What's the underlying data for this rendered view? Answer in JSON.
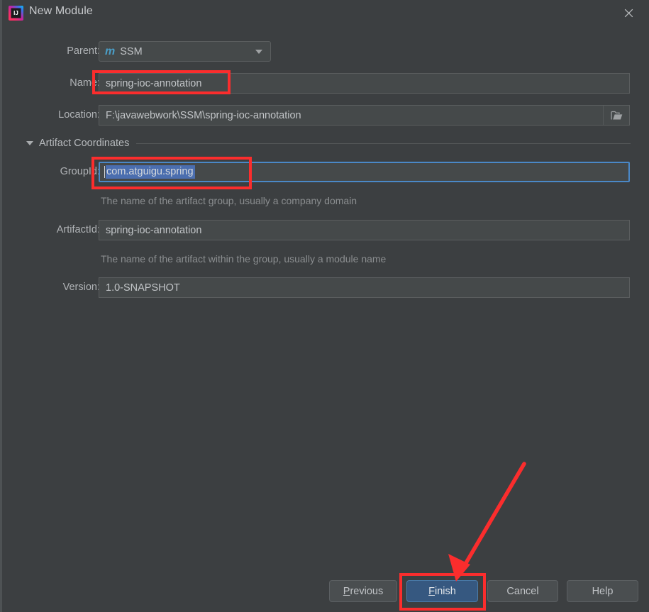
{
  "window": {
    "title": "New Module",
    "app_icon": "intellij-idea-logo",
    "close_icon": "close-icon",
    "background": "#3c3f41"
  },
  "form": {
    "parent": {
      "label": "Parent:",
      "value": "SSM",
      "icon": "maven-module-icon",
      "icon_glyph": "m",
      "icon_color": "#4a9ec7",
      "arrow_icon": "chevron-down-icon"
    },
    "name": {
      "label": "Name:",
      "value": "spring-ioc-annotation"
    },
    "location": {
      "label": "Location:",
      "value": "F:\\javawebwork\\SSM\\spring-ioc-annotation",
      "browse_icon": "folder-open-icon"
    },
    "artifact_section": {
      "label": "Artifact Coordinates",
      "expanded": true,
      "triangle_icon": "triangle-down-icon"
    },
    "group_id": {
      "label": "GroupId:",
      "value": "com.atguigu.spring",
      "help": "The name of the artifact group, usually a company domain",
      "focused": true,
      "selected": true,
      "focus_color": "#4a88c7",
      "selection_color": "#4b6eaf"
    },
    "artifact_id": {
      "label": "ArtifactId:",
      "value": "spring-ioc-annotation",
      "help": "The name of the artifact within the group, usually a module name"
    },
    "version": {
      "label": "Version:",
      "value": "1.0-SNAPSHOT"
    }
  },
  "buttons": {
    "previous": {
      "mnemonic": "P",
      "rest": "revious"
    },
    "finish": {
      "mnemonic": "F",
      "rest": "inish",
      "primary": true,
      "accent": "#365880"
    },
    "cancel": {
      "label": "Cancel"
    },
    "help": {
      "label": "Help"
    }
  },
  "annotations": {
    "color": "#fb2d2d",
    "boxes": [
      "name-field",
      "groupid-field",
      "finish-button"
    ],
    "arrow": {
      "from": "top-right",
      "to": "finish-button"
    }
  }
}
